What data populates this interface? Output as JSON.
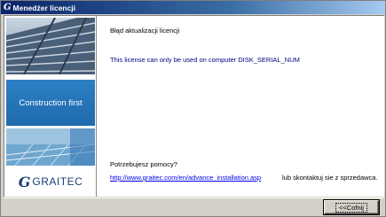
{
  "window": {
    "title": "Menedżer licencji",
    "title_logo": "G"
  },
  "left_panel": {
    "banner_text": "Construction first",
    "logo_letter": "G",
    "logo_text": "GRAITEC"
  },
  "content": {
    "heading": "Błąd aktualizacji licencji",
    "message": "This license can only be used on computer DISK_SERIAL_NUM",
    "help_question": "Potrzebujesz pomocy?",
    "help_link": "http://www.graitec.com/en/advance_installation.asp",
    "contact_text": "lub skontaktuj sie z sprzedawca."
  },
  "buttons": {
    "back_label": "<<Cofnij"
  },
  "colors": {
    "banner_blue": "#2d7fc4",
    "message_text": "#000080",
    "link": "#0000ee",
    "logo": "#1a3f7a"
  }
}
